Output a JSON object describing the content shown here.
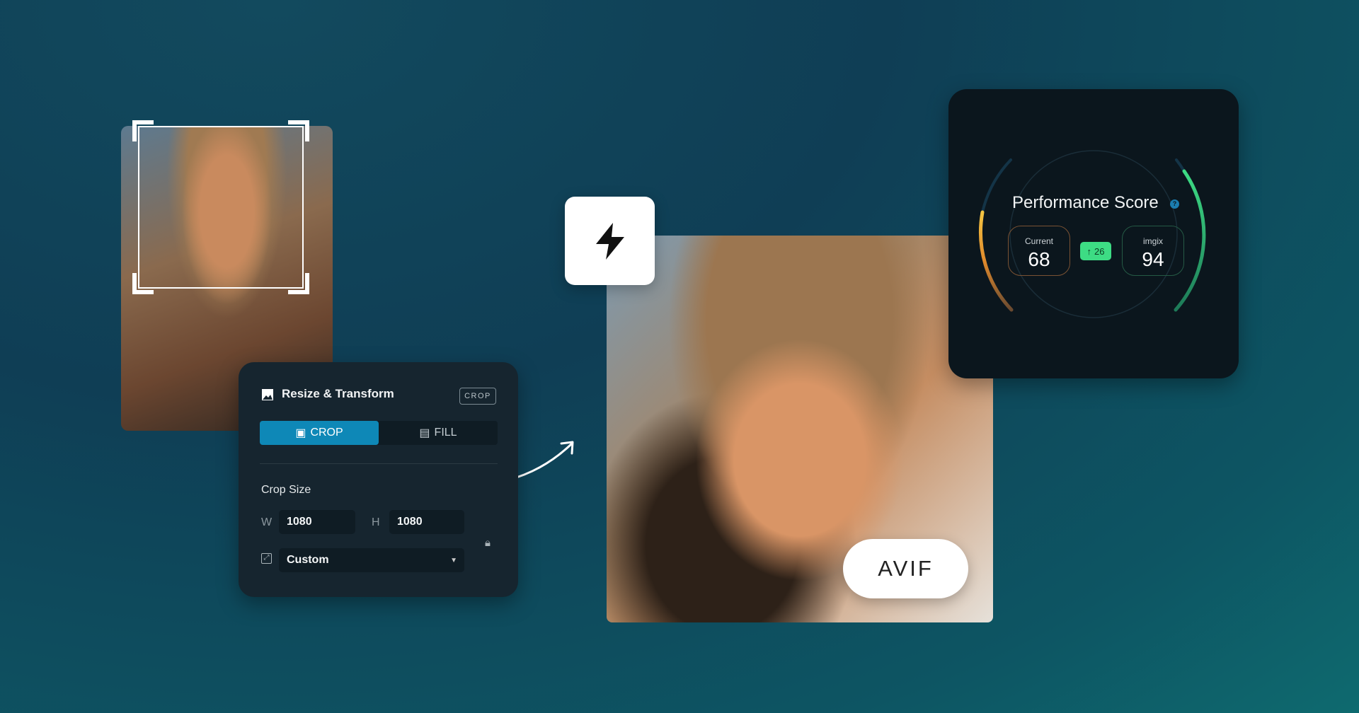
{
  "resize_panel": {
    "title": "Resize & Transform",
    "badge": "CROP",
    "tabs": [
      {
        "label": "CROP",
        "active": true
      },
      {
        "label": "FILL",
        "active": false
      }
    ],
    "crop_size_label": "Crop Size",
    "width_label": "W",
    "width_value": "1080",
    "height_label": "H",
    "height_value": "1080",
    "preset_value": "Custom"
  },
  "format_badge": "AVIF",
  "performance": {
    "title": "Performance Score",
    "current_label": "Current",
    "current_value": "68",
    "delta": "26",
    "imgix_label": "imgix",
    "imgix_value": "94",
    "colors": {
      "current": "#f0a030",
      "imgix": "#3ddc84",
      "delta_bg": "#3ddc84",
      "accent": "#0e88b7"
    }
  }
}
